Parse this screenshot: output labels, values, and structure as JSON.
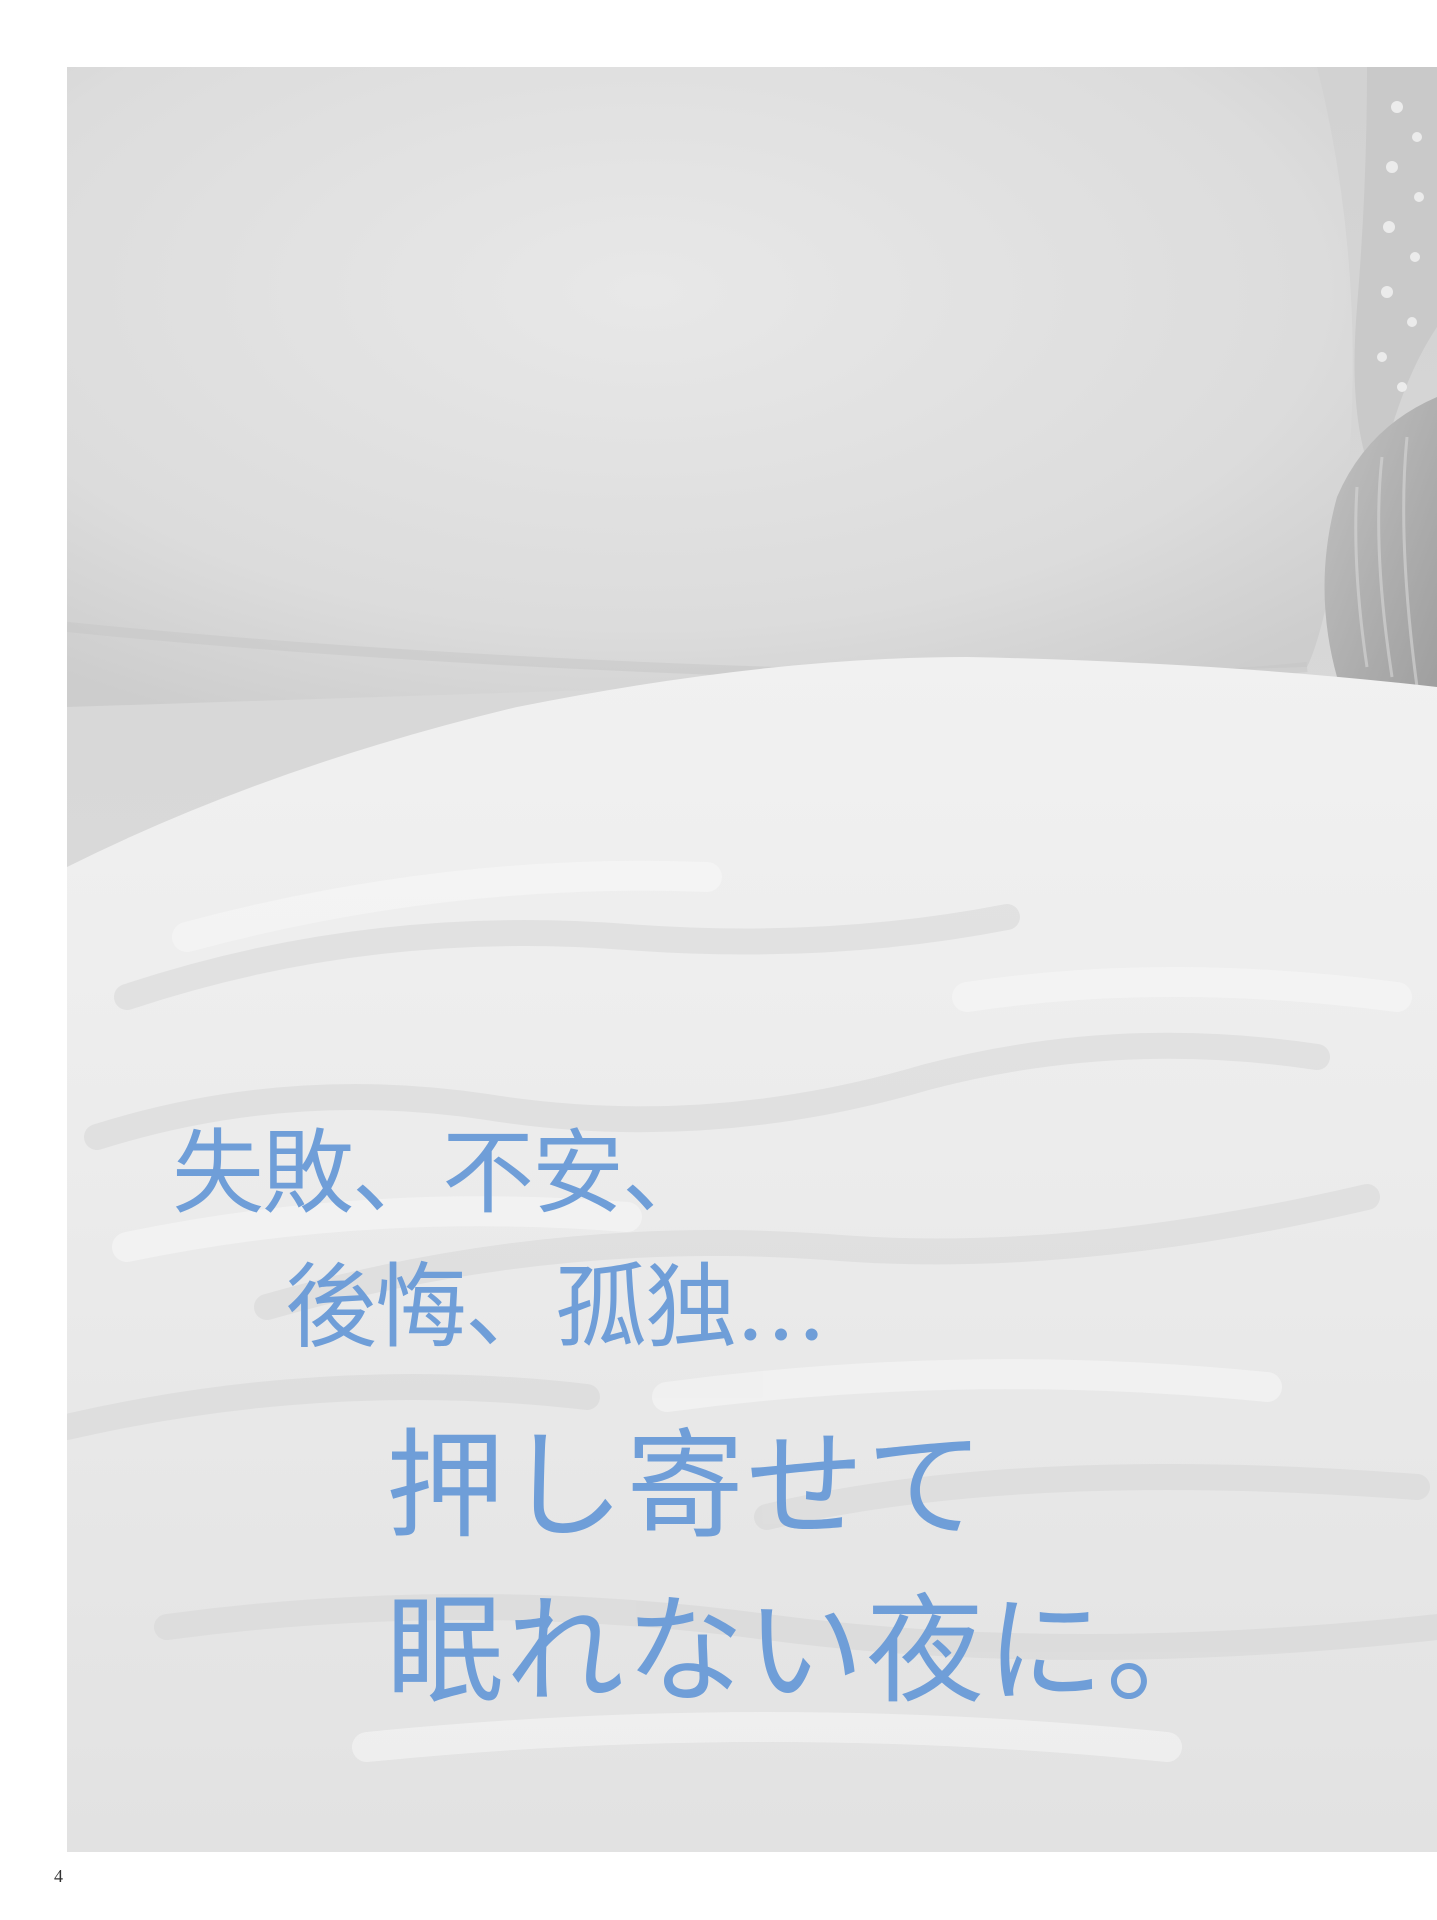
{
  "headline": {
    "line1": "失敗、不安、",
    "line2": "後悔、孤独…",
    "line3": "押し寄せて",
    "line4": "眠れない夜に。"
  },
  "page_number": "4",
  "colors": {
    "headline_text": "#6f9ed8",
    "photo_base": "#d7d7d7"
  }
}
